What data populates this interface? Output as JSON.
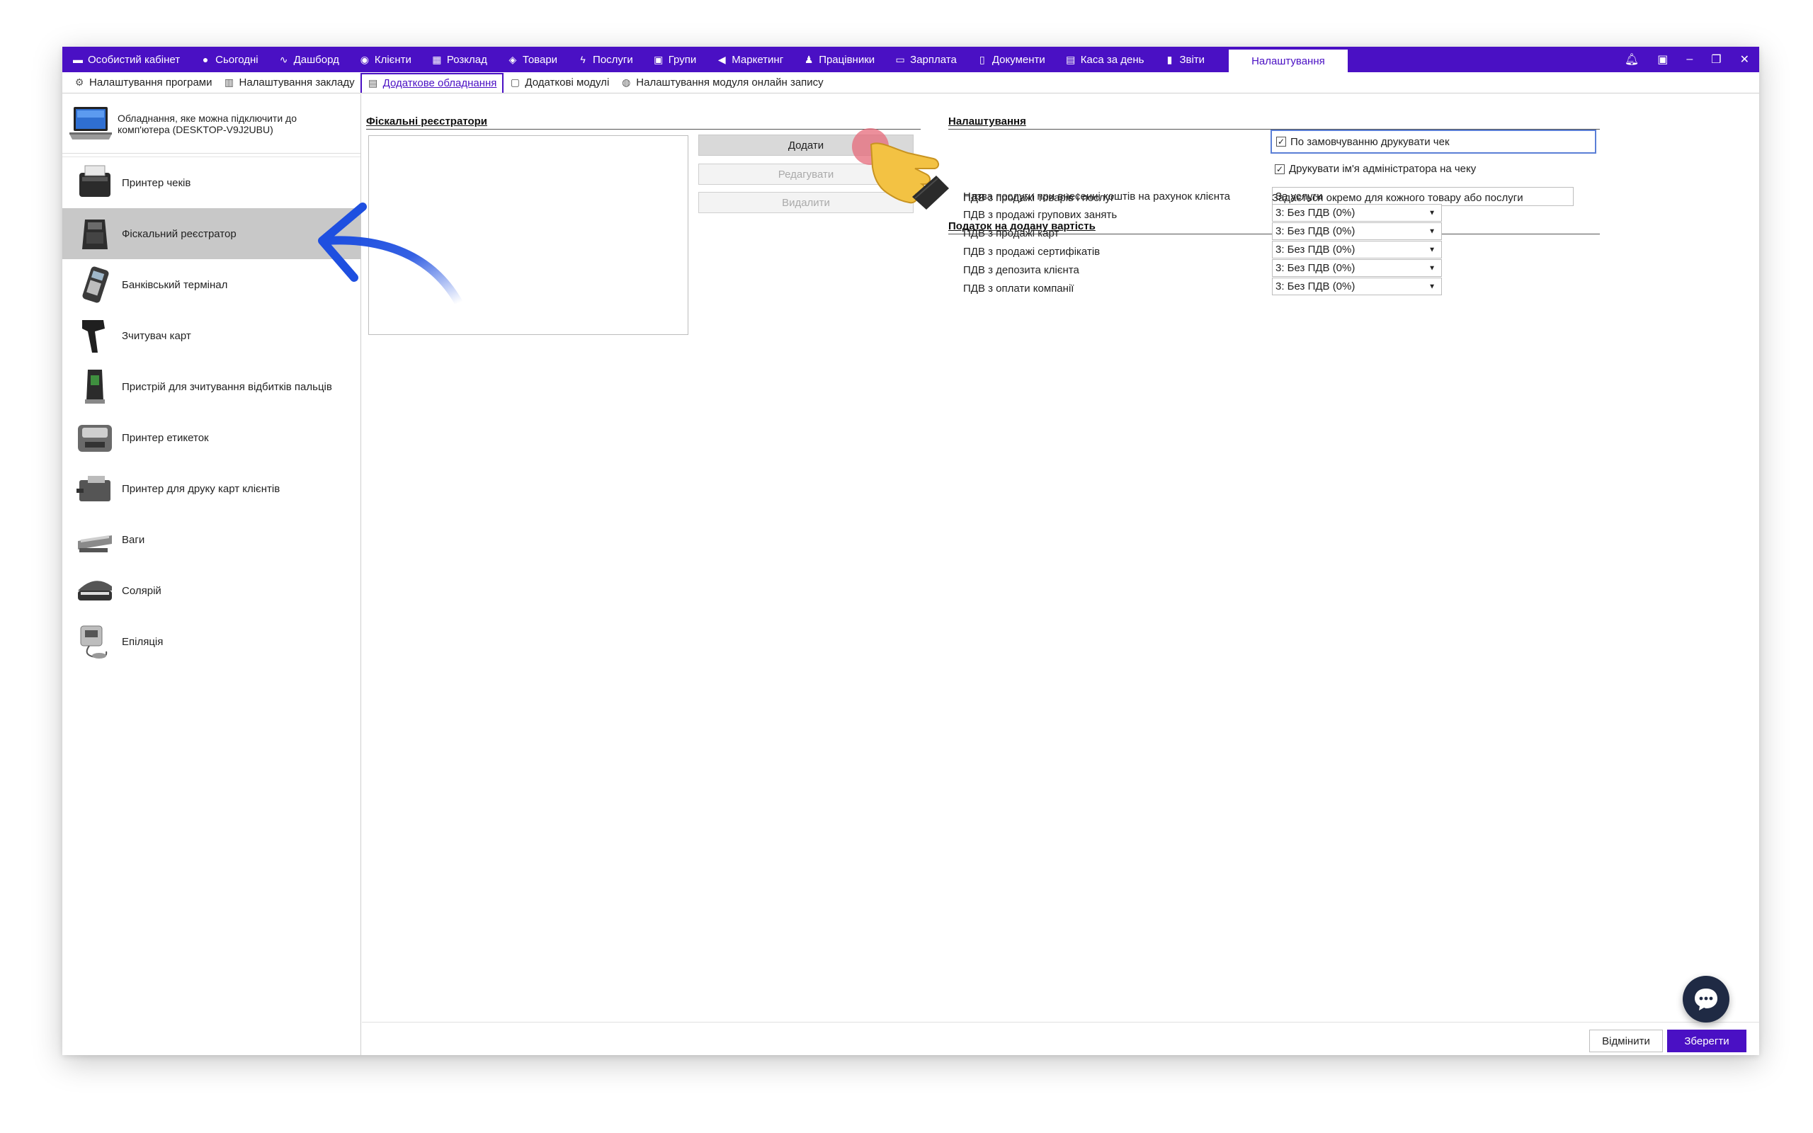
{
  "nav": {
    "items": [
      {
        "label": "Особистий кабінет",
        "icon": "briefcase-icon",
        "glyph": "▬"
      },
      {
        "label": "Сьогодні",
        "icon": "circle-icon",
        "glyph": "●"
      },
      {
        "label": "Дашборд",
        "icon": "pulse-icon",
        "glyph": "∿"
      },
      {
        "label": "Клієнти",
        "icon": "user-circle-icon",
        "glyph": "◉"
      },
      {
        "label": "Розклад",
        "icon": "calendar-icon",
        "glyph": "▦"
      },
      {
        "label": "Товари",
        "icon": "box-icon",
        "glyph": "◈"
      },
      {
        "label": "Послуги",
        "icon": "lightning-icon",
        "glyph": "ϟ"
      },
      {
        "label": "Групи",
        "icon": "group-icon",
        "glyph": "▣"
      },
      {
        "label": "Маркетинг",
        "icon": "megaphone-icon",
        "glyph": "◀"
      },
      {
        "label": "Працівники",
        "icon": "person-icon",
        "glyph": "♟"
      },
      {
        "label": "Зарплата",
        "icon": "money-icon",
        "glyph": "▭"
      },
      {
        "label": "Документи",
        "icon": "document-icon",
        "glyph": "▯"
      },
      {
        "label": "Каса за день",
        "icon": "calculator-icon",
        "glyph": "▤"
      },
      {
        "label": "Звіти",
        "icon": "bar-chart-icon",
        "glyph": "▮"
      }
    ],
    "active": "Налаштування"
  },
  "subtabs": [
    {
      "label": "Налаштування програми",
      "icon": "gear-icon",
      "glyph": "⚙"
    },
    {
      "label": "Налаштування закладу",
      "icon": "building-icon",
      "glyph": "▥"
    },
    {
      "label": "Додаткове обладнання",
      "icon": "printer-icon",
      "glyph": "▤"
    },
    {
      "label": "Додаткові модулі",
      "icon": "window-icon",
      "glyph": "▢"
    },
    {
      "label": "Налаштування модуля онлайн запису",
      "icon": "globe-icon",
      "glyph": "◍"
    }
  ],
  "sidebar": {
    "header": "Обладнання, яке можна підключити до комп'ютера (DESKTOP-V9J2UBU)",
    "items": [
      {
        "label": "Принтер чеків",
        "icon": "receipt-printer-icon"
      },
      {
        "label": "Фіскальний реєстратор",
        "icon": "fiscal-register-icon"
      },
      {
        "label": "Банківський термінал",
        "icon": "bank-terminal-icon"
      },
      {
        "label": "Зчитувач карт",
        "icon": "card-scanner-icon"
      },
      {
        "label": "Пристрій для зчитування відбитків пальців",
        "icon": "fingerprint-reader-icon"
      },
      {
        "label": "Принтер етикеток",
        "icon": "label-printer-icon"
      },
      {
        "label": "Принтер для друку карт клієнтів",
        "icon": "card-printer-icon"
      },
      {
        "label": "Ваги",
        "icon": "scales-icon"
      },
      {
        "label": "Солярій",
        "icon": "solarium-icon"
      },
      {
        "label": "Епіляція",
        "icon": "epilation-icon"
      }
    ],
    "selected_index": 1
  },
  "fiscal": {
    "title": "Фіскальні реєстратори",
    "add": "Додати",
    "edit": "Редагувати",
    "delete": "Видалити"
  },
  "settings": {
    "title": "Налаштування",
    "print_on_order": "По замовчуванню друкувати чек",
    "print_on_order_checked": true,
    "print_admin": "Друкувати ім'я адміністратора на чеку",
    "print_admin_checked": true,
    "service_name_label": "Назва послуги при внесенні коштів на рахунок клієнта",
    "service_name_value": "За услуги"
  },
  "vat": {
    "title": "Податок на додану вартість",
    "rows": [
      {
        "label": "ПДВ з продажі товарів і послуг",
        "value": "Задається окремо для кожного товару або послуги",
        "type": "text"
      },
      {
        "label": "ПДВ з продажі групових занять",
        "value": "3: Без ПДВ (0%)",
        "type": "select"
      },
      {
        "label": "ПДВ з продажі карт",
        "value": "3: Без ПДВ (0%)",
        "type": "select"
      },
      {
        "label": "ПДВ з продажі сертифікатів",
        "value": "3: Без ПДВ (0%)",
        "type": "select"
      },
      {
        "label": "ПДВ з депозита клієнта",
        "value": "3: Без ПДВ (0%)",
        "type": "select"
      },
      {
        "label": "ПДВ з оплати компанії",
        "value": "3: Без ПДВ (0%)",
        "type": "select"
      }
    ]
  },
  "footer": {
    "cancel": "Відмінити",
    "save": "Зберегти"
  },
  "colors": {
    "brand": "#4a10c4",
    "arrow": "#1e4fe0",
    "hand": "#f3c243",
    "click_marker": "#e56a7a"
  }
}
